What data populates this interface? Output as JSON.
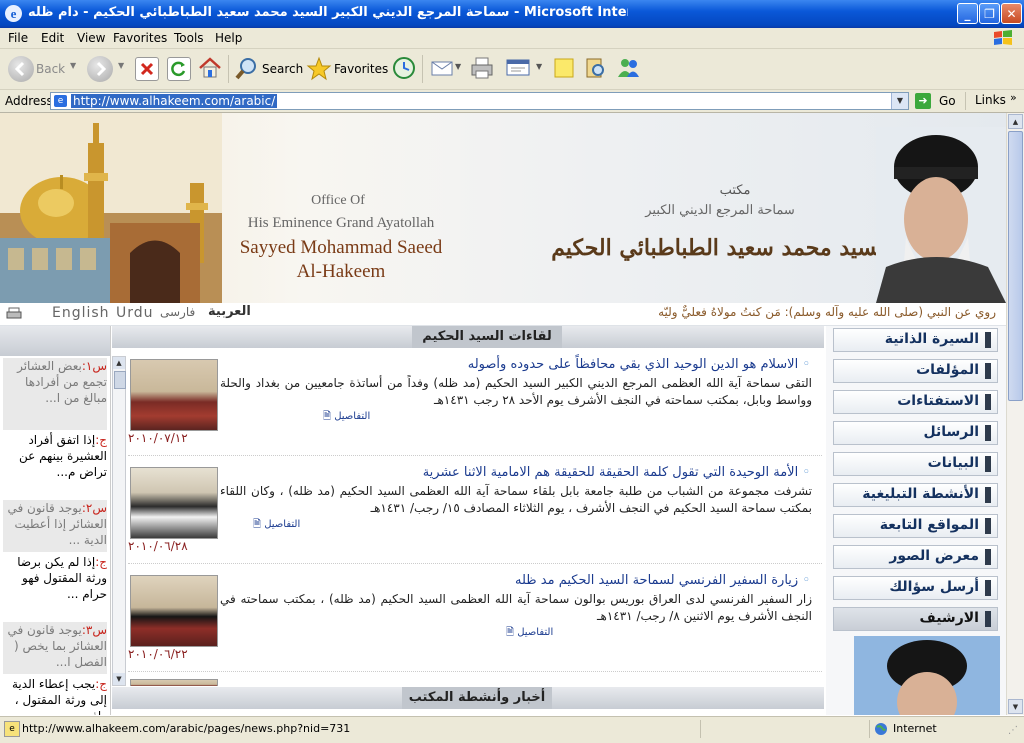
{
  "window": {
    "title": "سماحة المرجع الديني الكبير السيد محمد سعيد الطباطبائي الحكيم - دام ظله - Microsoft Internet Explorer"
  },
  "menu": [
    "File",
    "Edit",
    "View",
    "Favorites",
    "Tools",
    "Help"
  ],
  "toolbar": {
    "back": "Back",
    "search": "Search",
    "favorites": "Favorites"
  },
  "address": {
    "label": "Address",
    "url": "http://www.alhakeem.com/arabic/",
    "go": "Go",
    "links": "Links"
  },
  "banner": {
    "office_of": "Office Of",
    "line2": "His Eminence Grand Ayatollah",
    "line3": "Sayyed Mohammad Saeed",
    "line4": "Al-Hakeem",
    "ar_small1": "مكتب",
    "ar_small2": "سماحة المرجع الديني الكبير",
    "ar_big": "السيد محمد سعيد الطباطبائي الحكيم"
  },
  "languages": {
    "english": "English",
    "urdu": "Urdu",
    "farsi": "فارسی",
    "arabic": "العربية"
  },
  "ticker": "روي عن النبي (صلى الله عليه وآله وسلم): مَن كنتُ مولاهُ فعليٌّ وليّه",
  "section_title": "لقاءات السيد الحكيم",
  "bottom_section_title": "أخبار وأنشطة المكتب",
  "news": [
    {
      "title": "الاسلام هو الدين الوحيد الذي بقي محافظاً على حدوده وأصوله",
      "body": "التقى سماحة آية الله العظمى المرجع الديني الكبير السيد الحكيم (مد ظله) وفداً من أساتذة جامعيين من بغداد والحلة وواسط وبابل، بمكتب سماحته في النجف الأشرف يوم الأحد ٢٨ رجب ١٤٣١هـ",
      "details": "التفاصيل",
      "date": "٢٠١٠/٠٧/١٢"
    },
    {
      "title": "الأمة الوحيدة التي تقول كلمة الحقيقة للحقيقة هم الامامية الاثنا عشرية",
      "body": "تشرفت مجموعة من الشباب من طلبة جامعة بابل بلقاء سماحة آية الله العظمى السيد الحكيم (مد ظله) ، وكان اللقاء بمكتب سماحة السيد الحكيم في النجف الأشرف ، يوم الثلاثاء المصادف ١٥/ رجب/ ١٤٣١هـ",
      "details": "التفاصيل",
      "date": "٢٠١٠/٠٦/٢٨"
    },
    {
      "title": "زيارة السفير الفرنسي لسماحة السيد الحكيم مد ظله",
      "body": "زار السفير الفرنسي لدى العراق بوريس بوالون سماحة آية الله العظمى السيد الحكيم (مد ظله) ، بمكتب سماحته في النجف الأشرف يوم الاثنين ٨/ رجب/ ١٤٣١هـ",
      "details": "التفاصيل",
      "date": "٢٠١٠/٠٦/٢٢"
    }
  ],
  "nav": [
    "السيرة الذاتية",
    "المؤلفات",
    "الاستفتاءات",
    "الرسائل",
    "البيانات",
    "الأنشطة التبليغية",
    "المواقع التابعة",
    "معرض الصور",
    "أرسل سؤالك",
    "الارشيف"
  ],
  "faq": [
    {
      "q_tag": "س١:",
      "q": "بعض العشائر تجمع من أفرادها مبالغ من ا...",
      "a_tag": "ج:",
      "a": "إذا اتفق أفراد العشيرة بينهم عن تراض م..."
    },
    {
      "q_tag": "س٢:",
      "q": "يوجد قانون في العشائر إذا أعطيت الدية ...",
      "a_tag": "ج:",
      "a": "إذا لم يكن برضا ورثة المقتول فهو حرام ..."
    },
    {
      "q_tag": "س٣:",
      "q": "يوجد قانون في العشائر بما يخص ( الفصل ا...",
      "a_tag": "ج:",
      "a": "يجب إعطاء الدية إلى ورثة المقتول ، وإذ..."
    }
  ],
  "status": {
    "url": "http://www.alhakeem.com/arabic/pages/news.php?nid=731",
    "zone": "Internet"
  },
  "colors": {
    "link": "#1b3b8f",
    "title_red": "#c8241c",
    "date": "#8a2020",
    "nav_text": "#14315f"
  }
}
